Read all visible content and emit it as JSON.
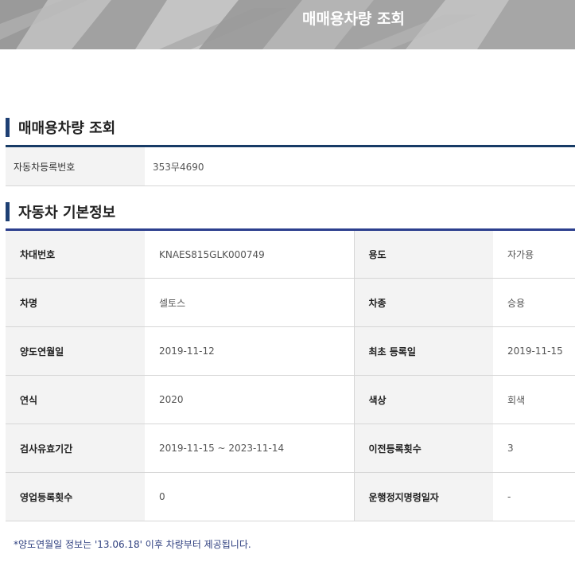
{
  "banner": {
    "title": "매매용차량 조회"
  },
  "query_section": {
    "title": "매매용차량 조회",
    "rows": [
      {
        "label": "자동차등록번호",
        "value": "353무4690"
      }
    ]
  },
  "info_section": {
    "title": "자동차 기본정보",
    "rows": [
      {
        "label1": "차대번호",
        "value1": "KNAES815GLK000749",
        "label2": "용도",
        "value2": "자가용"
      },
      {
        "label1": "차명",
        "value1": "셀토스",
        "label2": "차종",
        "value2": "승용"
      },
      {
        "label1": "양도연월일",
        "value1": "2019-11-12",
        "label2": "최초 등록일",
        "value2": "2019-11-15"
      },
      {
        "label1": "연식",
        "value1": "2020",
        "label2": "색상",
        "value2": "회색"
      },
      {
        "label1": "검사유효기간",
        "value1": "2019-11-15 ~ 2023-11-14",
        "label2": "이전등록횟수",
        "value2": "3"
      },
      {
        "label1": "영업등록횟수",
        "value1": "0",
        "label2": "운행정지명령일자",
        "value2": "-"
      }
    ]
  },
  "footnote": "*양도연월일 정보는 '13.06.18' 이후 차량부터 제공됩니다.",
  "colors": {
    "section_bar": "#1d3f73",
    "table_border": "#2c3f8e",
    "label_bg": "#f3f3f3",
    "footnote": "#2e3f7f"
  }
}
